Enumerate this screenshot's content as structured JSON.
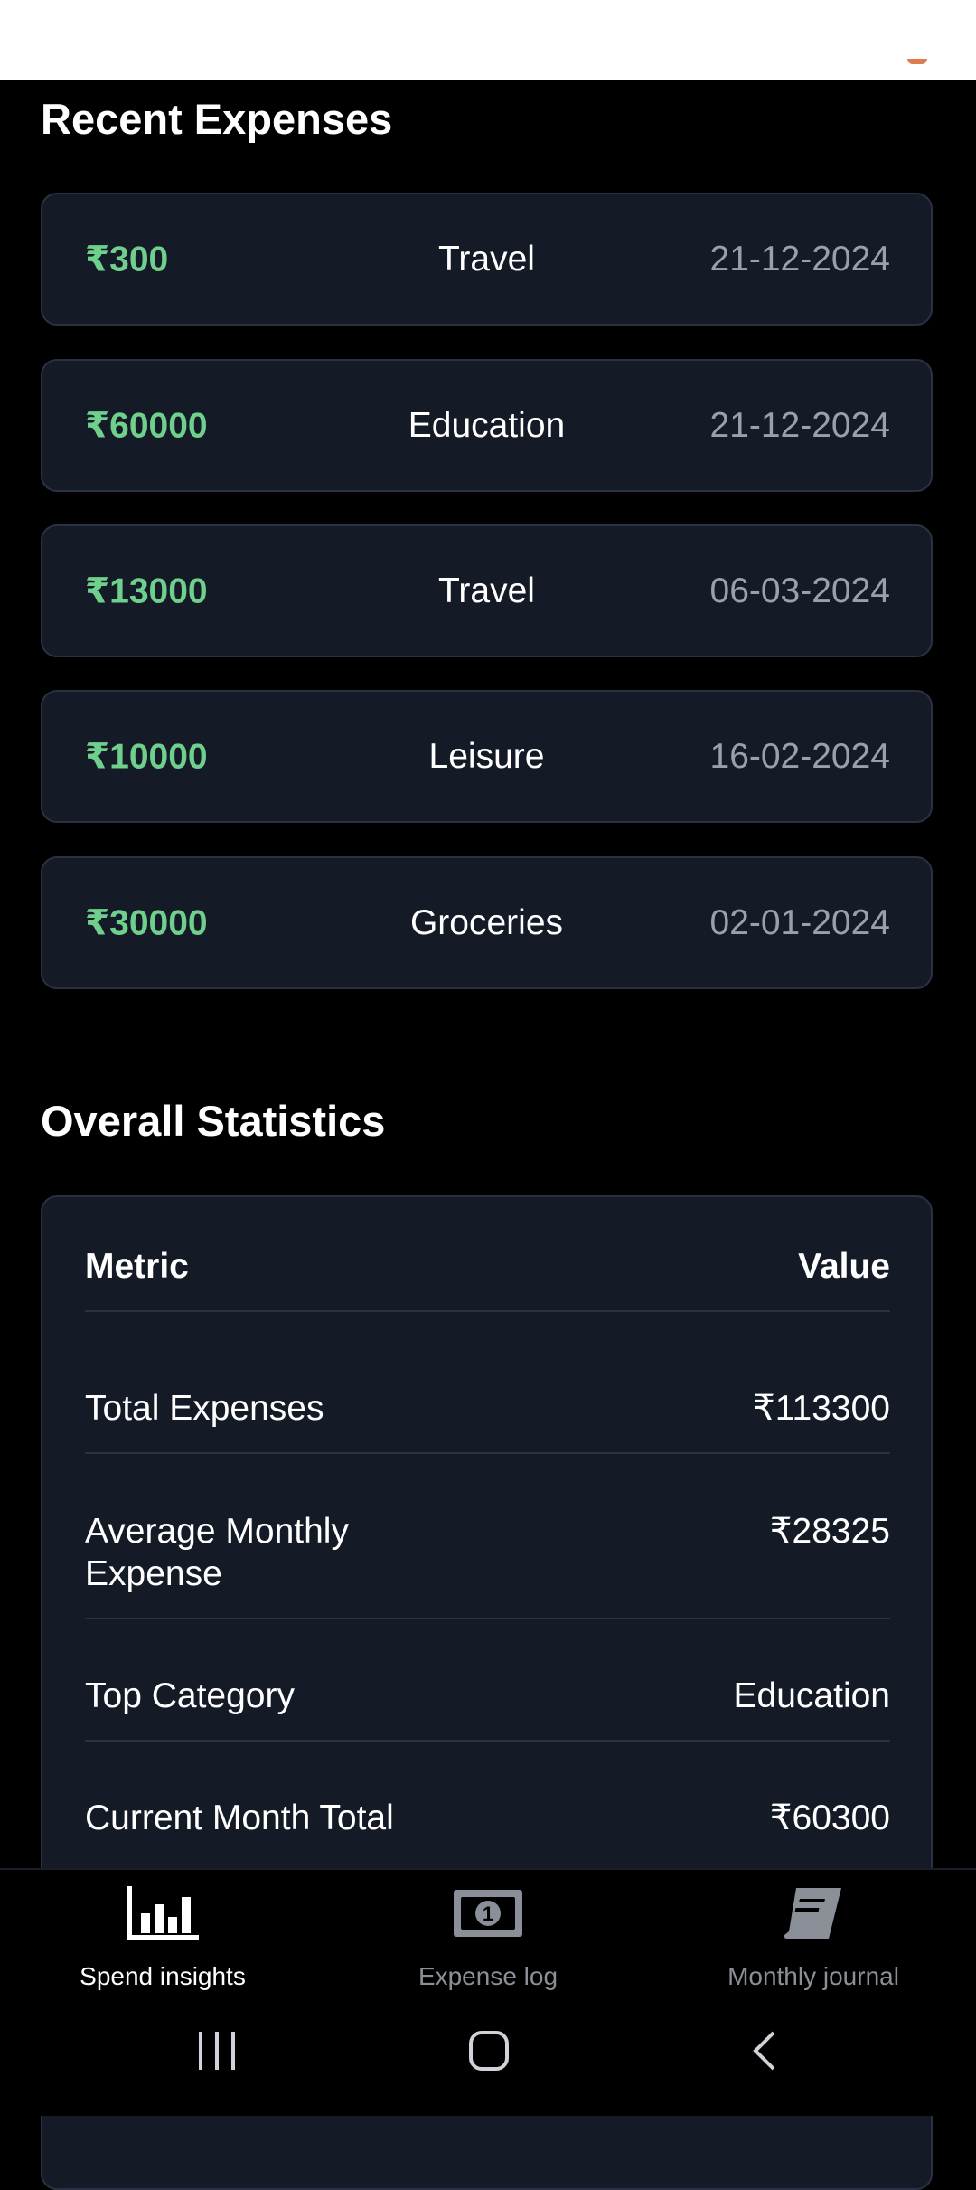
{
  "recent": {
    "title": "Recent Expenses",
    "items": [
      {
        "amount": "₹300",
        "category": "Travel",
        "date": "21-12-2024"
      },
      {
        "amount": "₹60000",
        "category": "Education",
        "date": "21-12-2024"
      },
      {
        "amount": "₹13000",
        "category": "Travel",
        "date": "06-03-2024"
      },
      {
        "amount": "₹10000",
        "category": "Leisure",
        "date": "16-02-2024"
      },
      {
        "amount": "₹30000",
        "category": "Groceries",
        "date": "02-01-2024"
      }
    ]
  },
  "stats": {
    "title": "Overall Statistics",
    "header_metric": "Metric",
    "header_value": "Value",
    "rows": [
      {
        "label": "Total Expenses",
        "value": "₹113300"
      },
      {
        "label": "Average Monthly Expense",
        "value": "₹28325"
      },
      {
        "label": "Top Category",
        "value": "Education"
      },
      {
        "label": "Current Month Total",
        "value": "₹60300"
      }
    ]
  },
  "nav": {
    "items": [
      {
        "label": "Spend insights",
        "icon": "bar-chart-icon",
        "active": true
      },
      {
        "label": "Expense log",
        "icon": "money-bill-icon",
        "active": false
      },
      {
        "label": "Monthly journal",
        "icon": "book-icon",
        "active": false
      }
    ]
  },
  "colors": {
    "accent_green": "#6fcf8c",
    "card_bg": "#151a27",
    "background": "#000000"
  }
}
